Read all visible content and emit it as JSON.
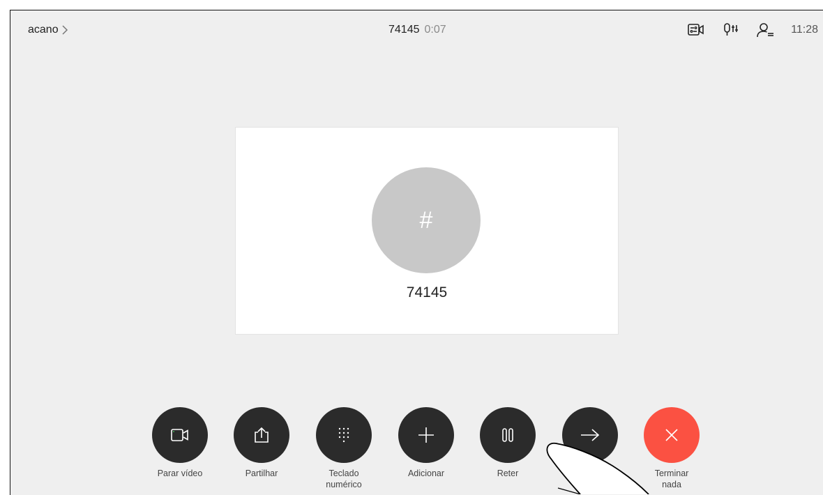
{
  "header": {
    "brand": "acano",
    "call_number": "74145",
    "call_duration": "0:07",
    "clock": "11:28"
  },
  "status_icons": [
    "layout-icon",
    "microphone-settings-icon",
    "participants-icon"
  ],
  "participant": {
    "avatar_glyph": "#",
    "name": "74145"
  },
  "controls": [
    {
      "id": "stop-video",
      "label": "Parar vídeo",
      "icon": "video-camera-icon"
    },
    {
      "id": "share",
      "label": "Partilhar",
      "icon": "share-icon"
    },
    {
      "id": "keypad",
      "label": "Teclado\nnumérico",
      "icon": "keypad-icon"
    },
    {
      "id": "add",
      "label": "Adicionar",
      "icon": "plus-icon"
    },
    {
      "id": "hold",
      "label": "Reter",
      "icon": "pause-icon"
    },
    {
      "id": "transfer",
      "label": "",
      "icon": "arrow-right-icon"
    },
    {
      "id": "end-call",
      "label": "Terminar\nnada",
      "icon": "close-icon"
    }
  ],
  "colors": {
    "background": "#efefef",
    "button": "#2b2b2b",
    "end_call": "#fb5142",
    "avatar": "#c8c8c8"
  }
}
